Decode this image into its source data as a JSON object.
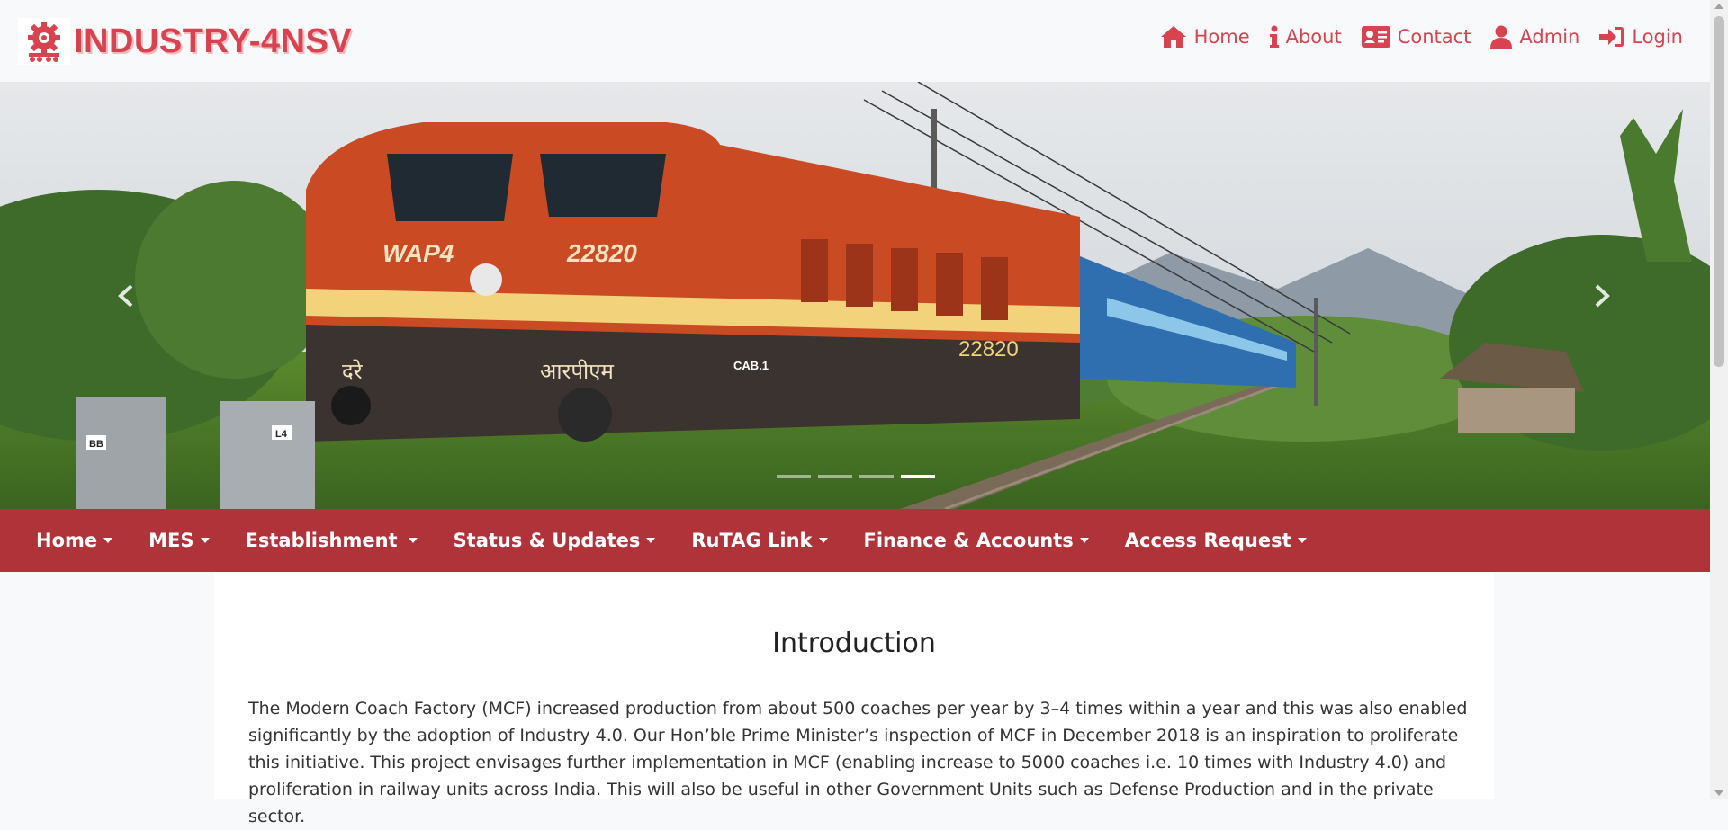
{
  "brand": {
    "title": "INDUSTRY-4NSV",
    "logo": "railway-gear-logo-icon",
    "color": "#d9434f"
  },
  "topnav": [
    {
      "label": "Home",
      "icon": "house-icon"
    },
    {
      "label": "About",
      "icon": "info-icon"
    },
    {
      "label": "Contact",
      "icon": "contact-card-icon"
    },
    {
      "label": "Admin",
      "icon": "user-icon"
    },
    {
      "label": "Login",
      "icon": "sign-in-icon"
    }
  ],
  "carousel": {
    "loco_model": "WAP4",
    "loco_number": "22820",
    "side_number": "22820",
    "cab_label": "CAB.1",
    "hindi_left": "दरे",
    "hindi_right": "आरपीएम",
    "box_label_1": "BB",
    "box_label_2": "L4",
    "slides": 4,
    "active_slide": 4,
    "prev_icon": "chevron-left-icon",
    "next_icon": "chevron-right-icon"
  },
  "menu": {
    "background": "#b0333a",
    "items": [
      {
        "label": "Home"
      },
      {
        "label": "MES"
      },
      {
        "label": "Establishment"
      },
      {
        "label": "Status & Updates"
      },
      {
        "label": "RuTAG Link"
      },
      {
        "label": "Finance & Accounts"
      },
      {
        "label": "Access Request"
      }
    ]
  },
  "intro": {
    "heading": "Introduction",
    "body": "The Modern Coach Factory (MCF) increased production from about 500 coaches per year by 3–4 times within a year and this was also enabled significantly by the adoption of Industry 4.0. Our Hon’ble Prime Minister’s inspection of MCF in December 2018 is an inspiration to proliferate this initiative. This project envisages further implementation in MCF (enabling increase to 5000 coaches i.e. 10 times with Industry 4.0) and proliferation in railway units across India. This will also be useful in other Government Units such as Defense Production and in the private sector."
  }
}
